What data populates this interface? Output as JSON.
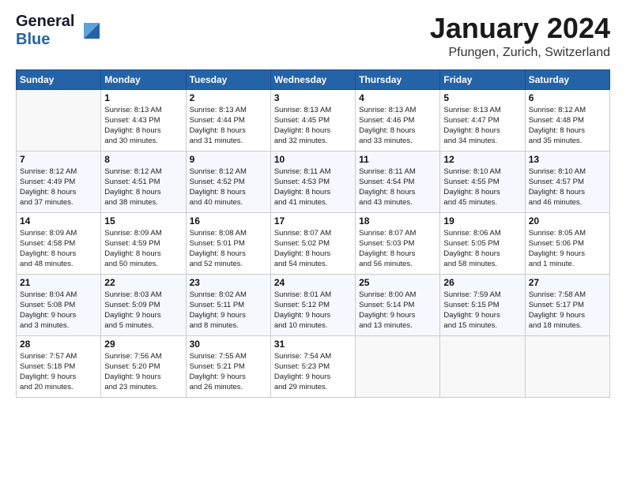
{
  "header": {
    "logo_line1": "General",
    "logo_line2": "Blue",
    "month_title": "January 2024",
    "location": "Pfungen, Zurich, Switzerland"
  },
  "weekdays": [
    "Sunday",
    "Monday",
    "Tuesday",
    "Wednesday",
    "Thursday",
    "Friday",
    "Saturday"
  ],
  "weeks": [
    [
      {
        "day": "",
        "empty": true
      },
      {
        "day": "1",
        "sunrise": "8:13 AM",
        "sunset": "4:43 PM",
        "daylight": "8 hours and 30 minutes."
      },
      {
        "day": "2",
        "sunrise": "8:13 AM",
        "sunset": "4:44 PM",
        "daylight": "8 hours and 31 minutes."
      },
      {
        "day": "3",
        "sunrise": "8:13 AM",
        "sunset": "4:45 PM",
        "daylight": "8 hours and 32 minutes."
      },
      {
        "day": "4",
        "sunrise": "8:13 AM",
        "sunset": "4:46 PM",
        "daylight": "8 hours and 33 minutes."
      },
      {
        "day": "5",
        "sunrise": "8:13 AM",
        "sunset": "4:47 PM",
        "daylight": "8 hours and 34 minutes."
      },
      {
        "day": "6",
        "sunrise": "8:12 AM",
        "sunset": "4:48 PM",
        "daylight": "8 hours and 35 minutes."
      }
    ],
    [
      {
        "day": "7",
        "sunrise": "8:12 AM",
        "sunset": "4:49 PM",
        "daylight": "8 hours and 37 minutes."
      },
      {
        "day": "8",
        "sunrise": "8:12 AM",
        "sunset": "4:51 PM",
        "daylight": "8 hours and 38 minutes."
      },
      {
        "day": "9",
        "sunrise": "8:12 AM",
        "sunset": "4:52 PM",
        "daylight": "8 hours and 40 minutes."
      },
      {
        "day": "10",
        "sunrise": "8:11 AM",
        "sunset": "4:53 PM",
        "daylight": "8 hours and 41 minutes."
      },
      {
        "day": "11",
        "sunrise": "8:11 AM",
        "sunset": "4:54 PM",
        "daylight": "8 hours and 43 minutes."
      },
      {
        "day": "12",
        "sunrise": "8:10 AM",
        "sunset": "4:55 PM",
        "daylight": "8 hours and 45 minutes."
      },
      {
        "day": "13",
        "sunrise": "8:10 AM",
        "sunset": "4:57 PM",
        "daylight": "8 hours and 46 minutes."
      }
    ],
    [
      {
        "day": "14",
        "sunrise": "8:09 AM",
        "sunset": "4:58 PM",
        "daylight": "8 hours and 48 minutes."
      },
      {
        "day": "15",
        "sunrise": "8:09 AM",
        "sunset": "4:59 PM",
        "daylight": "8 hours and 50 minutes."
      },
      {
        "day": "16",
        "sunrise": "8:08 AM",
        "sunset": "5:01 PM",
        "daylight": "8 hours and 52 minutes."
      },
      {
        "day": "17",
        "sunrise": "8:07 AM",
        "sunset": "5:02 PM",
        "daylight": "8 hours and 54 minutes."
      },
      {
        "day": "18",
        "sunrise": "8:07 AM",
        "sunset": "5:03 PM",
        "daylight": "8 hours and 56 minutes."
      },
      {
        "day": "19",
        "sunrise": "8:06 AM",
        "sunset": "5:05 PM",
        "daylight": "8 hours and 58 minutes."
      },
      {
        "day": "20",
        "sunrise": "8:05 AM",
        "sunset": "5:06 PM",
        "daylight": "9 hours and 1 minute."
      }
    ],
    [
      {
        "day": "21",
        "sunrise": "8:04 AM",
        "sunset": "5:08 PM",
        "daylight": "9 hours and 3 minutes."
      },
      {
        "day": "22",
        "sunrise": "8:03 AM",
        "sunset": "5:09 PM",
        "daylight": "9 hours and 5 minutes."
      },
      {
        "day": "23",
        "sunrise": "8:02 AM",
        "sunset": "5:11 PM",
        "daylight": "9 hours and 8 minutes."
      },
      {
        "day": "24",
        "sunrise": "8:01 AM",
        "sunset": "5:12 PM",
        "daylight": "9 hours and 10 minutes."
      },
      {
        "day": "25",
        "sunrise": "8:00 AM",
        "sunset": "5:14 PM",
        "daylight": "9 hours and 13 minutes."
      },
      {
        "day": "26",
        "sunrise": "7:59 AM",
        "sunset": "5:15 PM",
        "daylight": "9 hours and 15 minutes."
      },
      {
        "day": "27",
        "sunrise": "7:58 AM",
        "sunset": "5:17 PM",
        "daylight": "9 hours and 18 minutes."
      }
    ],
    [
      {
        "day": "28",
        "sunrise": "7:57 AM",
        "sunset": "5:18 PM",
        "daylight": "9 hours and 20 minutes."
      },
      {
        "day": "29",
        "sunrise": "7:56 AM",
        "sunset": "5:20 PM",
        "daylight": "9 hours and 23 minutes."
      },
      {
        "day": "30",
        "sunrise": "7:55 AM",
        "sunset": "5:21 PM",
        "daylight": "9 hours and 26 minutes."
      },
      {
        "day": "31",
        "sunrise": "7:54 AM",
        "sunset": "5:23 PM",
        "daylight": "9 hours and 29 minutes."
      },
      {
        "day": "",
        "empty": true
      },
      {
        "day": "",
        "empty": true
      },
      {
        "day": "",
        "empty": true
      }
    ]
  ]
}
